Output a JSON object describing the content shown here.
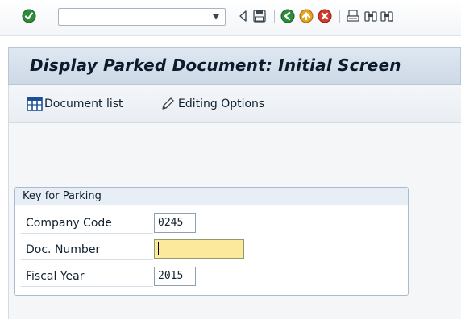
{
  "toolbar": {
    "command_field": {
      "value": "",
      "placeholder": ""
    },
    "icons": [
      "enter-icon",
      "back-icon",
      "save-icon",
      "back-nav-icon",
      "exit-icon",
      "cancel-icon",
      "print-icon",
      "find-icon",
      "find-next-icon"
    ]
  },
  "title": "Display Parked Document: Initial Screen",
  "app_toolbar": {
    "document_list_label": "Document list",
    "editing_options_label": "Editing Options"
  },
  "key_for_parking": {
    "title": "Key for Parking",
    "company_code": {
      "label": "Company Code",
      "value": "0245"
    },
    "doc_number": {
      "label": "Doc. Number",
      "value": ""
    },
    "fiscal_year": {
      "label": "Fiscal Year",
      "value": "2015"
    }
  },
  "colors": {
    "title_bg": "#d6e1ec",
    "focused_field": "#fde99b",
    "enter_green": "#2e8b3a",
    "exit_orange": "#e7a21a",
    "cancel_red": "#d23a2a"
  }
}
